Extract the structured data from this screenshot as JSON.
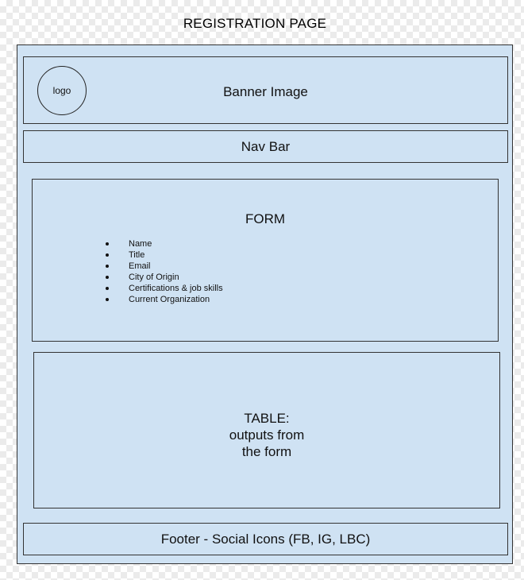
{
  "page_title": "REGISTRATION PAGE",
  "banner": {
    "logo_label": "logo",
    "label": "Banner Image"
  },
  "nav": {
    "label": "Nav Bar"
  },
  "form": {
    "title": "FORM",
    "fields": [
      "Name",
      "Title",
      "Email",
      "City of Origin",
      "Certifications & job skills",
      "Current Organization"
    ]
  },
  "table": {
    "lines": [
      "TABLE:",
      "outputs from",
      "the form"
    ]
  },
  "footer": {
    "label": "Footer - Social Icons (FB, IG, LBC)"
  },
  "colors": {
    "panel_fill": "#cfe2f3",
    "outline": "#333333"
  }
}
